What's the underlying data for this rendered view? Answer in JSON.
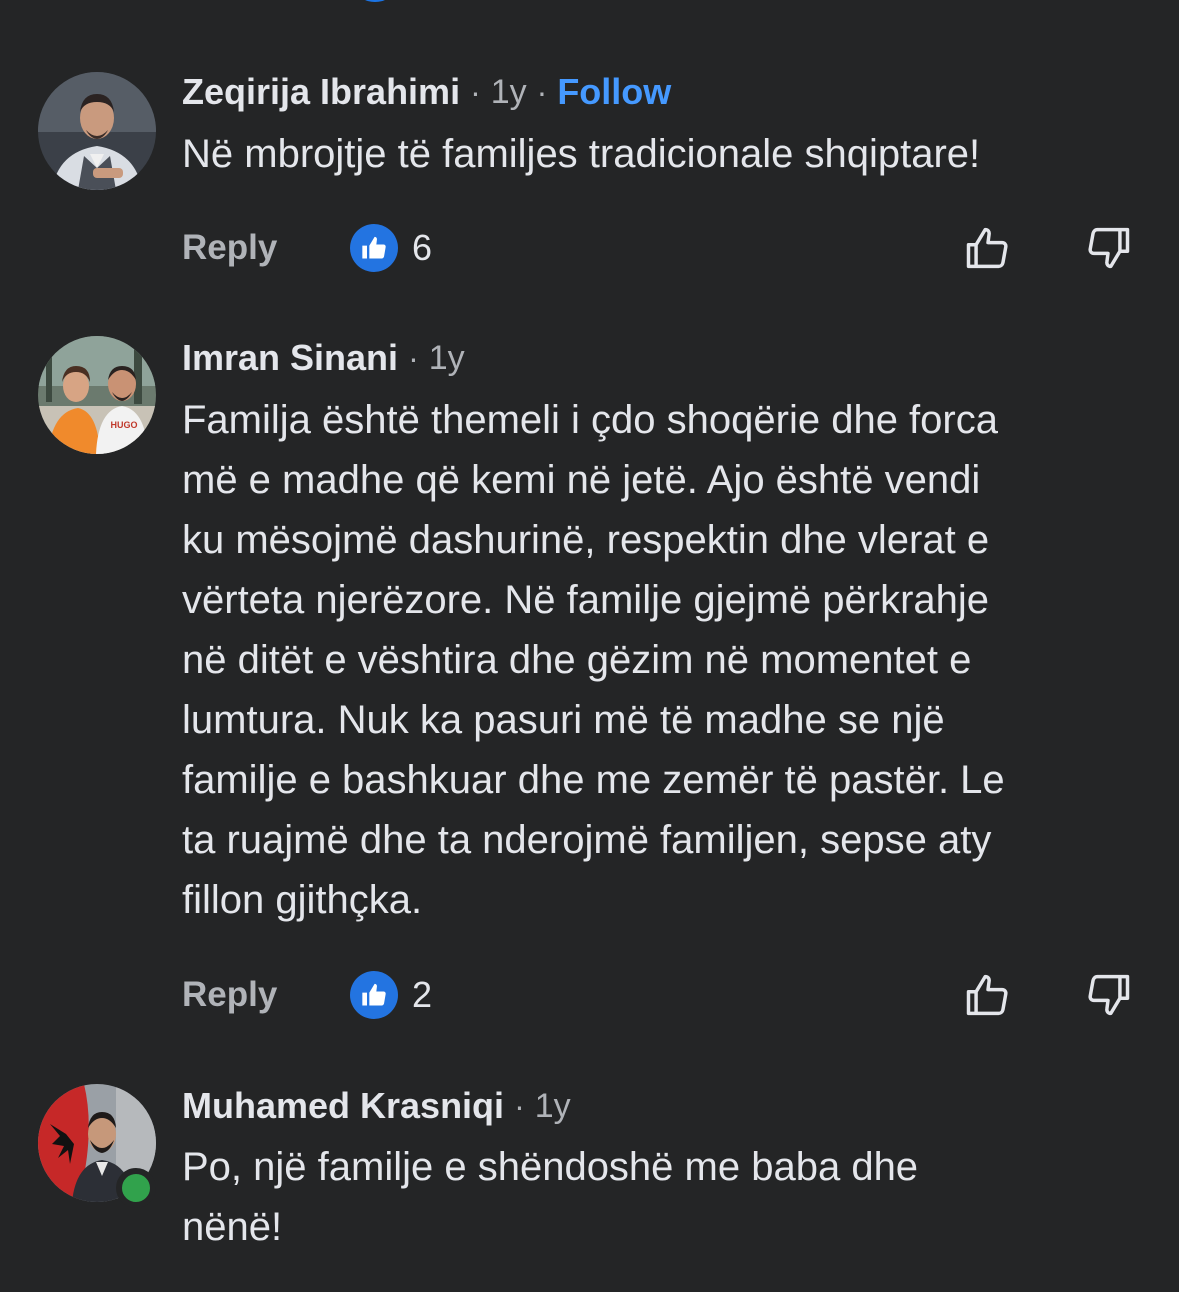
{
  "comments": [
    {
      "author": "Zeqirija Ibrahimi",
      "sep1": "·",
      "time": "1y",
      "sep2": "·",
      "follow": "Follow",
      "text": "Në mbrojtje të familjes tradicionale shqiptare!",
      "reply": "Reply",
      "likes": "6"
    },
    {
      "author": "Imran Sinani",
      "sep1": "·",
      "time": "1y",
      "text": "Familja është themeli i çdo shoqërie dhe forca\nmë e madhe që kemi në jetë. Ajo është vendi\nku mësojmë dashurinë, respektin dhe vlerat e\nvërteta njerëzore. Në familje gjejmë përkrahje\nnë ditët e vështira dhe gëzim në momentet e\nlumtura. Nuk ka pasuri më të madhe se një\nfamilje e bashkuar dhe me zemër të pastër. Le\nta ruajmë dhe ta nderojmë familjen, sepse aty\nfillon gjithçka.",
      "reply": "Reply",
      "likes": "2",
      "avatar_print": "HUGO"
    },
    {
      "author": "Muhamed Krasniqi",
      "sep1": "·",
      "time": "1y",
      "text": "Po, një familje e shëndoshë me baba dhe\nnënë!",
      "online": true
    }
  ],
  "icons": {
    "like_badge": "thumbs-up-icon",
    "like_button": "thumbs-up-outline-icon",
    "dislike_button": "thumbs-down-outline-icon"
  },
  "colors": {
    "background": "#242526",
    "text_primary": "#e4e6eb",
    "text_secondary": "#b0b3b8",
    "link": "#4599ff",
    "like_badge": "#2374e1",
    "online": "#31a24c"
  }
}
